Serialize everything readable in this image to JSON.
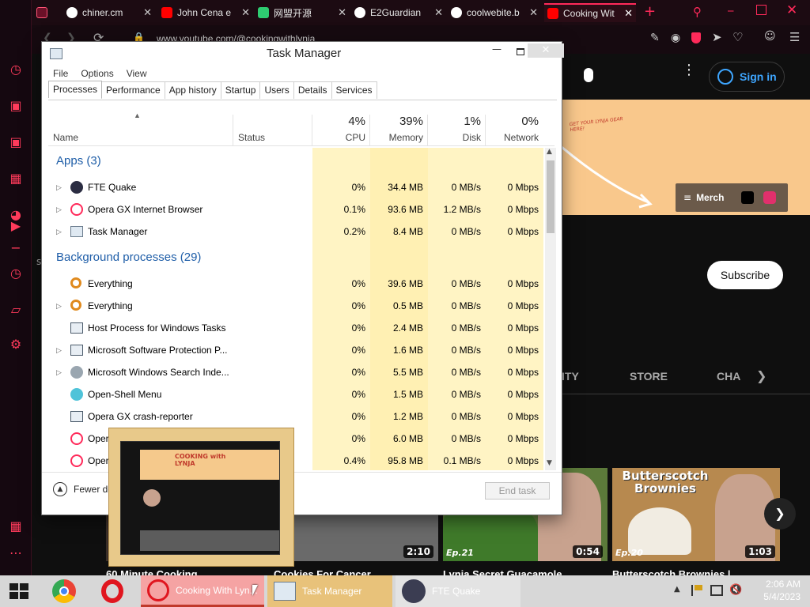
{
  "browser": {
    "tabs": [
      {
        "label": "",
        "icon": "gamepad-icon"
      },
      {
        "label": "chiner.cm",
        "icon": "globe-icon"
      },
      {
        "label": "John Cena e",
        "icon": "youtube-icon"
      },
      {
        "label": "网盟开源",
        "icon": "share-icon"
      },
      {
        "label": "E2Guardian",
        "icon": "github-icon"
      },
      {
        "label": "coolwebite.b",
        "icon": "globe-icon"
      },
      {
        "label": "Cooking Wit",
        "icon": "youtube-icon"
      }
    ],
    "address": "www.youtube.com/@cookingwithlynja",
    "accent": "#ff2a5a"
  },
  "youtube": {
    "sign_in": "Sign in",
    "banner_text": "GET YOUR LYNJA GEAR HERE!",
    "merch": "Merch",
    "subscribe": "Subscribe",
    "nav_tabs": [
      "ITY",
      "STORE",
      "CHA"
    ],
    "partial_left": "s",
    "videos": [
      {
        "title": "60 Minute Cooking",
        "duration": ""
      },
      {
        "title": "Cookies For Cancer",
        "duration": "2:10"
      },
      {
        "title": "Lynja Secret Guacamole",
        "duration": "0:54",
        "ep": "Ep.21"
      },
      {
        "title": "Butterscotch Brownies |",
        "duration": "1:03",
        "ep": "Ep.20",
        "overlay": "Butterscotch Brownies"
      }
    ]
  },
  "task_manager": {
    "title": "Task Manager",
    "menu": [
      "File",
      "Options",
      "View"
    ],
    "tabs": [
      "Processes",
      "Performance",
      "App history",
      "Startup",
      "Users",
      "Details",
      "Services"
    ],
    "columns": {
      "name": "Name",
      "status": "Status",
      "cpu": {
        "pct": "4%",
        "label": "CPU"
      },
      "memory": {
        "pct": "39%",
        "label": "Memory"
      },
      "disk": {
        "pct": "1%",
        "label": "Disk"
      },
      "network": {
        "pct": "0%",
        "label": "Network"
      }
    },
    "groups": [
      {
        "label": "Apps (3)",
        "rows": [
          {
            "name": "FTE Quake",
            "cpu": "0%",
            "memory": "34.4 MB",
            "disk": "0 MB/s",
            "network": "0 Mbps",
            "expand": true
          },
          {
            "name": "Opera GX Internet Browser",
            "cpu": "0.1%",
            "memory": "93.6 MB",
            "disk": "1.2 MB/s",
            "network": "0 Mbps",
            "expand": true
          },
          {
            "name": "Task Manager",
            "cpu": "0.2%",
            "memory": "8.4 MB",
            "disk": "0 MB/s",
            "network": "0 Mbps",
            "expand": true
          }
        ]
      },
      {
        "label": "Background processes (29)",
        "rows": [
          {
            "name": "Everything",
            "cpu": "0%",
            "memory": "39.6 MB",
            "disk": "0 MB/s",
            "network": "0 Mbps",
            "expand": false
          },
          {
            "name": "Everything",
            "cpu": "0%",
            "memory": "0.5 MB",
            "disk": "0 MB/s",
            "network": "0 Mbps",
            "expand": true
          },
          {
            "name": "Host Process for Windows Tasks",
            "cpu": "0%",
            "memory": "2.4 MB",
            "disk": "0 MB/s",
            "network": "0 Mbps",
            "expand": false
          },
          {
            "name": "Microsoft Software Protection P...",
            "cpu": "0%",
            "memory": "1.6 MB",
            "disk": "0 MB/s",
            "network": "0 Mbps",
            "expand": true
          },
          {
            "name": "Microsoft Windows Search Inde...",
            "cpu": "0%",
            "memory": "5.5 MB",
            "disk": "0 MB/s",
            "network": "0 Mbps",
            "expand": true
          },
          {
            "name": "Open-Shell Menu",
            "cpu": "0%",
            "memory": "1.5 MB",
            "disk": "0 MB/s",
            "network": "0 Mbps",
            "expand": false
          },
          {
            "name": "Opera GX crash-reporter",
            "cpu": "0%",
            "memory": "1.2 MB",
            "disk": "0 MB/s",
            "network": "0 Mbps",
            "expand": false
          },
          {
            "name": "Oper",
            "cpu": "0%",
            "memory": "6.0 MB",
            "disk": "0 MB/s",
            "network": "0 Mbps",
            "expand": false
          },
          {
            "name": "Oper",
            "cpu": "0.4%",
            "memory": "95.8 MB",
            "disk": "0.1 MB/s",
            "network": "0 Mbps",
            "expand": false
          }
        ]
      }
    ],
    "fewer_details": "Fewer de",
    "end_task": "End task"
  },
  "thumbnail_preview": {
    "title": "COOKING with LYNJA",
    "close": "×"
  },
  "taskbar": {
    "items": [
      {
        "label": "Cooking With Lyn..."
      },
      {
        "label": "Task Manager"
      },
      {
        "label": "FTE Quake"
      }
    ],
    "time": "2:06 AM",
    "date": "5/4/2023"
  }
}
